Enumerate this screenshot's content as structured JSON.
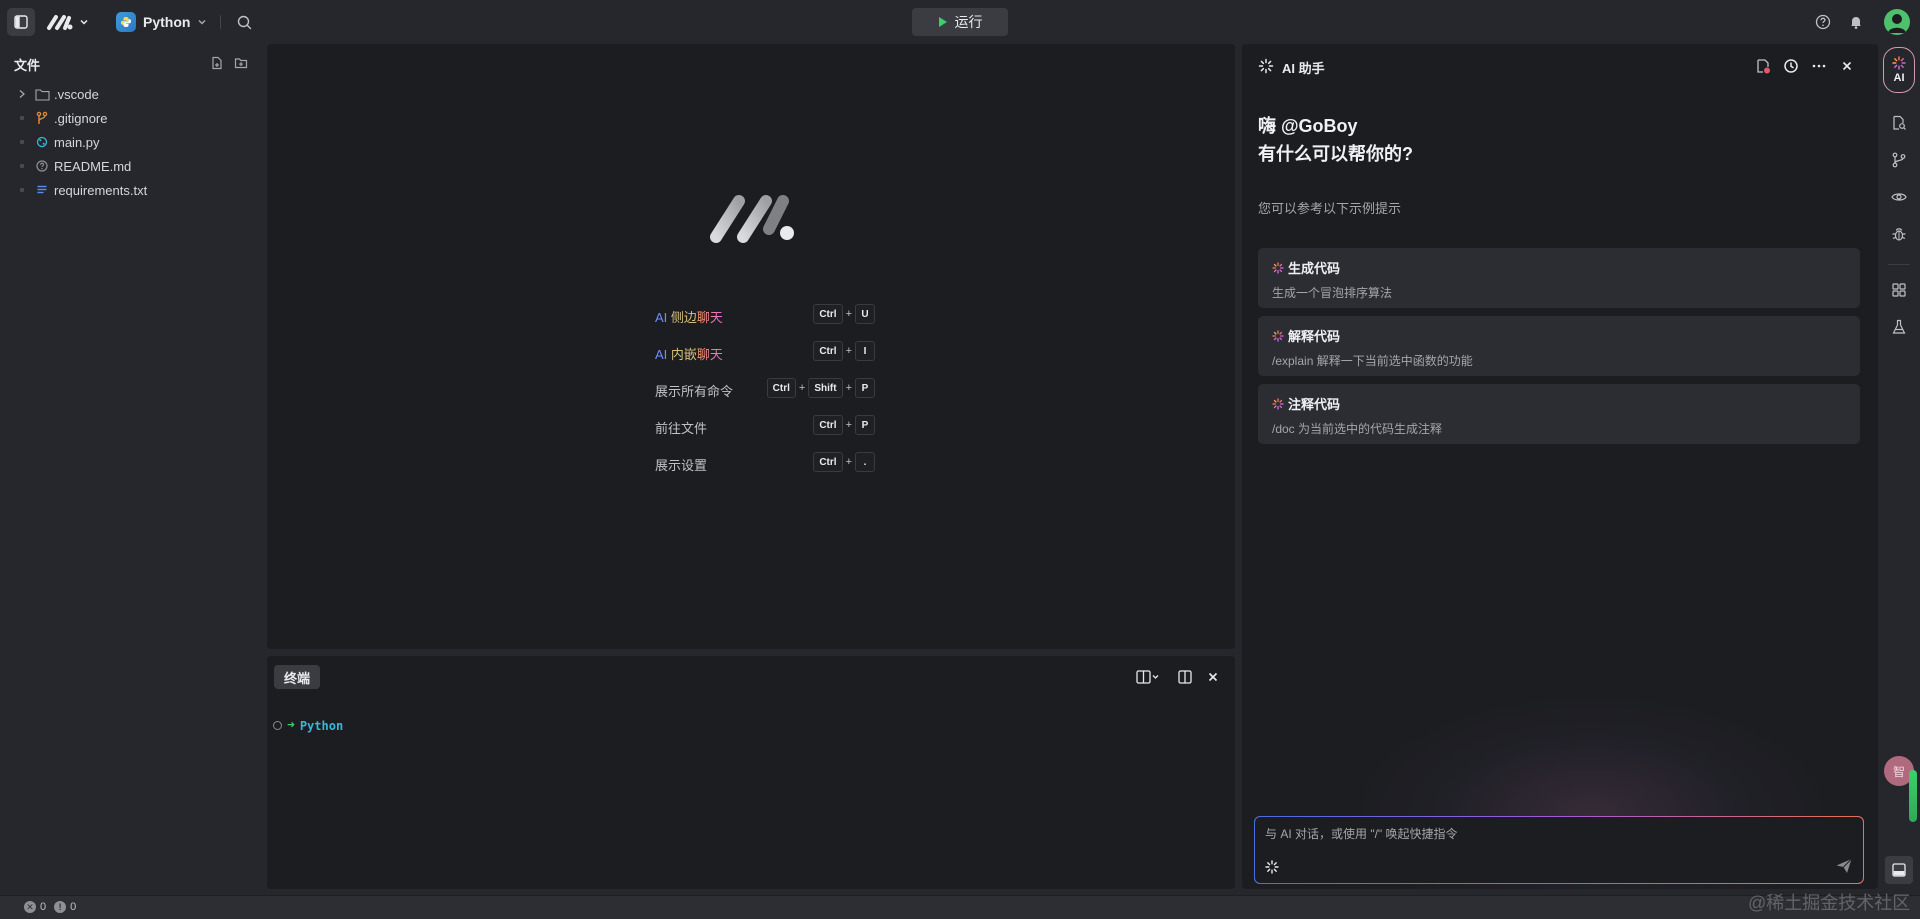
{
  "topbar": {
    "env_label": "Python",
    "run_label": "运行"
  },
  "explorer": {
    "title": "文件",
    "items": [
      {
        "label": ".vscode",
        "kind": "folder"
      },
      {
        "label": ".gitignore",
        "kind": "git"
      },
      {
        "label": "main.py",
        "kind": "python"
      },
      {
        "label": "README.md",
        "kind": "readme"
      },
      {
        "label": "requirements.txt",
        "kind": "text"
      }
    ]
  },
  "welcome": {
    "shortcuts": [
      {
        "label_parts": [
          "AI",
          " 侧边",
          "聊天"
        ],
        "keys": [
          "Ctrl",
          "U"
        ]
      },
      {
        "label_parts": [
          "AI",
          " 内嵌",
          "聊天"
        ],
        "keys": [
          "Ctrl",
          "I"
        ]
      },
      {
        "label": "展示所有命令",
        "keys": [
          "Ctrl",
          "Shift",
          "P"
        ]
      },
      {
        "label": "前往文件",
        "keys": [
          "Ctrl",
          "P"
        ]
      },
      {
        "label": "展示设置",
        "keys": [
          "Ctrl",
          "."
        ]
      }
    ]
  },
  "terminal": {
    "tab_label": "终端",
    "prompt_env": "Python",
    "prompt_arrow": "➜"
  },
  "ai_panel": {
    "title": "AI 助手",
    "greeting_line1": "嗨 @GoBoy",
    "greeting_line2": "有什么可以帮你的?",
    "hint": "您可以参考以下示例提示",
    "cards": [
      {
        "title": "生成代码",
        "desc": "生成一个冒泡排序算法"
      },
      {
        "title": "解释代码",
        "desc": "/explain 解释一下当前选中函数的功能"
      },
      {
        "title": "注释代码",
        "desc": "/doc 为当前选中的代码生成注释"
      }
    ],
    "input_placeholder": "与 AI 对话，或使用 \"/\" 唤起快捷指令"
  },
  "activity": {
    "ai_label": "AI",
    "bubble_text": "智"
  },
  "statusbar": {
    "errors": "0",
    "warnings": "0"
  },
  "watermark": "@稀土掘金技术社区",
  "colors": {
    "background": "#26272c",
    "panel": "#1c1d21",
    "accent_green": "#3ccf6b",
    "python_blue": "#36b9d8"
  }
}
